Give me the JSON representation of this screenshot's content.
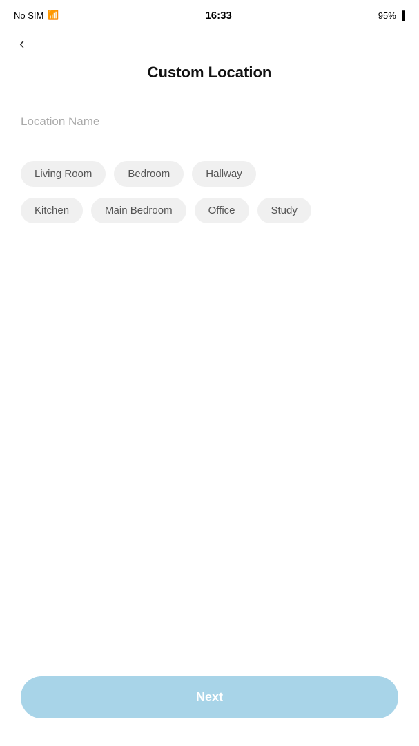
{
  "statusBar": {
    "carrier": "No SIM",
    "time": "16:33",
    "battery": "95%",
    "batteryIcon": "🔋"
  },
  "header": {
    "backLabel": "‹",
    "title": "Custom Location"
  },
  "input": {
    "placeholder": "Location Name",
    "value": ""
  },
  "tags": {
    "row1": [
      {
        "id": "living-room",
        "label": "Living Room"
      },
      {
        "id": "bedroom",
        "label": "Bedroom"
      },
      {
        "id": "hallway",
        "label": "Hallway"
      }
    ],
    "row2": [
      {
        "id": "kitchen",
        "label": "Kitchen"
      },
      {
        "id": "main-bedroom",
        "label": "Main Bedroom"
      },
      {
        "id": "office",
        "label": "Office"
      },
      {
        "id": "study",
        "label": "Study"
      }
    ]
  },
  "footer": {
    "nextLabel": "Next"
  }
}
